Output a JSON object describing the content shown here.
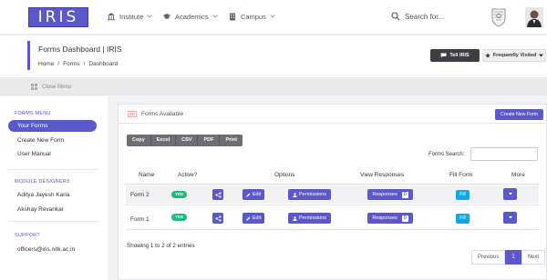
{
  "brand": {
    "logo_text": "IRIS"
  },
  "nav": {
    "items": [
      {
        "label": "Institute"
      },
      {
        "label": "Academics"
      },
      {
        "label": "Campus"
      }
    ],
    "search_label": "Search for..."
  },
  "header": {
    "title": "Forms Dashboard | IRIS",
    "breadcrumb": [
      "Home",
      "/",
      "Forms",
      "/",
      "Dashboard"
    ],
    "tell_iris": "Tell IRIS",
    "frequently_visited": "Frequently Visited"
  },
  "close_menu": "Close Menu",
  "sidebar": {
    "forms_menu_title": "FORMS MENU",
    "forms_items": [
      "Your Forms",
      "Create New Form",
      "User Manual"
    ],
    "designers_title": "MODULE DESIGNERS",
    "designers": [
      "Aditya Jayesh Karia",
      "Akshay Revankar"
    ],
    "support_title": "SUPPORT",
    "support_email": "officers@iris.nitk.ac.in"
  },
  "card": {
    "title": "Forms Available",
    "create_button": "Create New Form",
    "export_buttons": [
      "Copy",
      "Excel",
      "CSV",
      "PDF",
      "Print"
    ],
    "search_label": "Forms Search:",
    "columns": [
      "Name",
      "Active?",
      "Options",
      "View Responses",
      "Fill Form",
      "More"
    ],
    "rows": [
      {
        "name": "Form 2",
        "active": "YES",
        "edit": "Edit",
        "permissions": "Permissions",
        "responses": "Responses",
        "response_count": "0",
        "fill": "Fill"
      },
      {
        "name": "Form 1",
        "active": "YES",
        "edit": "Edit",
        "permissions": "Permissions",
        "responses": "Responses",
        "response_count": "0",
        "fill": "Fill"
      }
    ],
    "info": "Showing 1 to 2 of 2 entries",
    "pagination": {
      "previous": "Previous",
      "page": "1",
      "next": "Next"
    }
  },
  "colors": {
    "accent": "#5b59c9",
    "success": "#1fb97b",
    "info": "#16a6e4",
    "dark": "#3e3e44"
  }
}
